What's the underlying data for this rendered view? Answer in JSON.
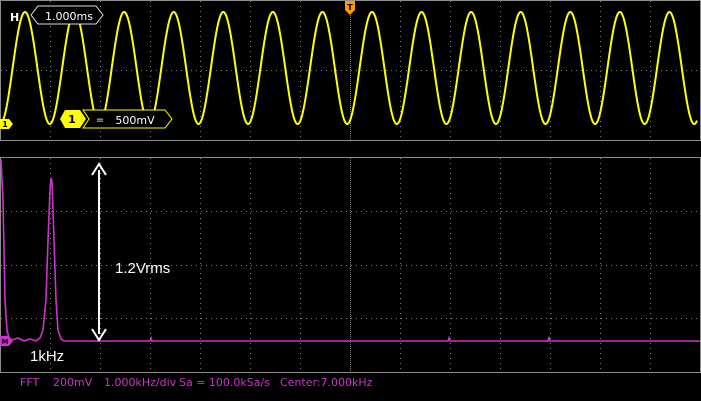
{
  "timebase": {
    "label": "H",
    "value": "1.000ms"
  },
  "trigger": {
    "marker": "T"
  },
  "channel1": {
    "marker": "1",
    "badge": "1",
    "coupling_symbol": "=",
    "scale": "500mV",
    "color": "#ffff00",
    "cycles_visible": 14
  },
  "math": {
    "marker": "M",
    "color": "#cc33cc",
    "annotation_amplitude": "1.2Vrms",
    "annotation_frequency": "1kHz"
  },
  "fft_status": {
    "mode": "FFT",
    "scale": "200mV",
    "freq_div": "1.000kHz/div",
    "sample_rate": "Sa = 100.0kSa/s",
    "center": "Center:7.000kHz"
  },
  "colors": {
    "background": "#000000",
    "grid": "#7f7f7f",
    "border": "#8c8c8c",
    "trigger": "#ff9900",
    "annotation": "#ffffff"
  }
}
